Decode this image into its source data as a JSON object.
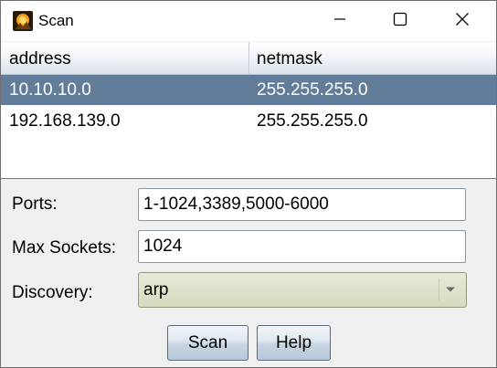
{
  "window": {
    "title": "Scan"
  },
  "table": {
    "columns": [
      "address",
      "netmask"
    ],
    "rows": [
      {
        "address": "10.10.10.0",
        "netmask": "255.255.255.0",
        "selected": true
      },
      {
        "address": "192.168.139.0",
        "netmask": "255.255.255.0",
        "selected": false
      }
    ]
  },
  "form": {
    "ports_label": "Ports:",
    "ports_value": "1-1024,3389,5000-6000",
    "max_sockets_label": "Max Sockets:",
    "max_sockets_value": "1024",
    "discovery_label": "Discovery:",
    "discovery_value": "arp"
  },
  "buttons": {
    "scan_label": "Scan",
    "help_label": "Help"
  },
  "colors": {
    "selection": "#617d9a",
    "discovery_select": "#d5dbbd"
  },
  "icons": {
    "app": "app-icon",
    "minimize": "minimize-icon",
    "maximize": "maximize-icon",
    "close": "close-icon",
    "dropdown": "chevron-down-icon"
  }
}
